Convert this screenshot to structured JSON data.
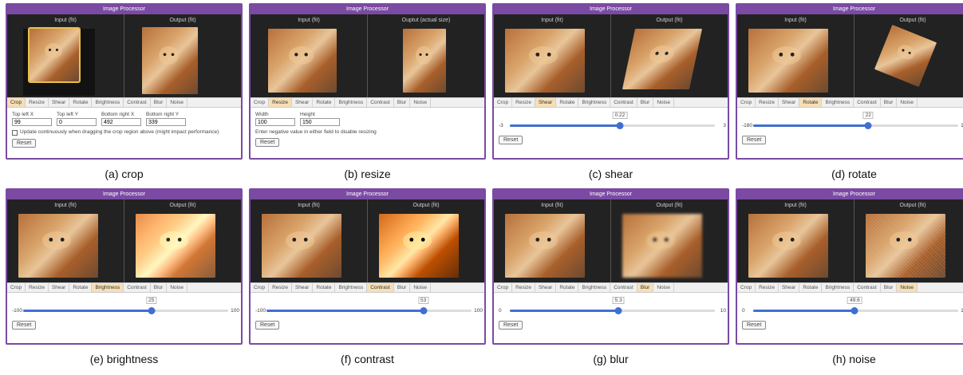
{
  "app_title": "Image Processor",
  "tabs": [
    "Crop",
    "Resize",
    "Shear",
    "Rotate",
    "Brightness",
    "Contrast",
    "Blur",
    "Noise"
  ],
  "reset_label": "Reset",
  "colors": {
    "frame": "#7b4aa3",
    "accent": "#3f6fd1",
    "active_tab": "#f6dfb6"
  },
  "panels": [
    {
      "caption": "(a) crop",
      "input_label": "Input (fit)",
      "output_label": "Output (fit)",
      "active": "Crop",
      "fields": [
        {
          "label": "Top left X",
          "value": "99"
        },
        {
          "label": "Top left Y",
          "value": "0"
        },
        {
          "label": "Bottom right X",
          "value": "492"
        },
        {
          "label": "Bottom right Y",
          "value": "339"
        }
      ],
      "checkbox": "Update continuously when dragging the crop region above (might impact performance)"
    },
    {
      "caption": "(b) resize",
      "input_label": "Input (fit)",
      "output_label": "Ouptut (actual size)",
      "active": "Resize",
      "fields": [
        {
          "label": "Width",
          "value": "100"
        },
        {
          "label": "Height",
          "value": "150"
        }
      ],
      "hint": "Enter negative value in either field to disable resizing"
    },
    {
      "caption": "(c) shear",
      "input_label": "Input (fit)",
      "output_label": "Output (fit)",
      "active": "Shear",
      "slider": {
        "min": -3,
        "max": 3,
        "value": 0.22,
        "min_label": "-3",
        "max_label": "3",
        "value_label": "0.22"
      }
    },
    {
      "caption": "(d) rotate",
      "input_label": "Input (fit)",
      "output_label": "Output (fit)",
      "active": "Rotate",
      "slider": {
        "min": -180,
        "max": 180,
        "value": 22,
        "min_label": "-180",
        "max_label": "180",
        "value_label": "22"
      }
    },
    {
      "caption": "(e) brightness",
      "input_label": "Input (fit)",
      "output_label": "Output (fit)",
      "active": "Brightness",
      "slider": {
        "min": -100,
        "max": 100,
        "value": 25,
        "min_label": "-100",
        "max_label": "100",
        "value_label": "25"
      }
    },
    {
      "caption": "(f) contrast",
      "input_label": "Input (fit)",
      "output_label": "Output (fit)",
      "active": "Contrast",
      "slider": {
        "min": -100,
        "max": 100,
        "value": 53,
        "min_label": "-100",
        "max_label": "100",
        "value_label": "53"
      }
    },
    {
      "caption": "(g) blur",
      "input_label": "Input (fit)",
      "output_label": "Output (fit)",
      "active": "Blur",
      "slider": {
        "min": 0,
        "max": 10,
        "value": 5.3,
        "min_label": "0",
        "max_label": "10",
        "value_label": "5.3"
      }
    },
    {
      "caption": "(h) noise",
      "input_label": "Input (fit)",
      "output_label": "Output (fit)",
      "active": "Noise",
      "slider": {
        "min": 0,
        "max": 100,
        "value": 49.6,
        "min_label": "0",
        "max_label": "100",
        "value_label": "49.6"
      }
    }
  ]
}
